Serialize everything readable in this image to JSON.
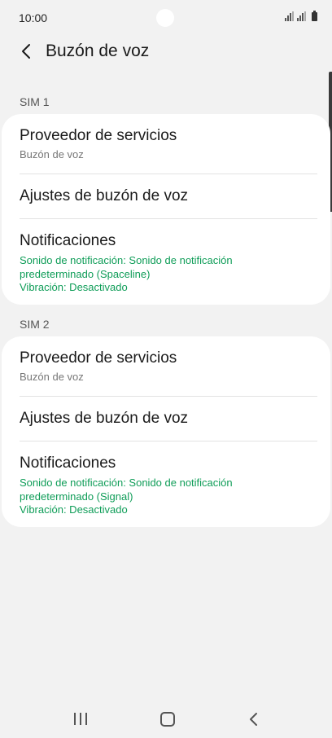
{
  "status_bar": {
    "time": "10:00"
  },
  "header": {
    "title": "Buzón de voz"
  },
  "sections": [
    {
      "label": "SIM 1",
      "items": [
        {
          "title": "Proveedor de servicios",
          "subtitle": "Buzón de voz"
        },
        {
          "title": "Ajustes de buzón de voz"
        },
        {
          "title": "Notificaciones",
          "detail_line1": "Sonido de notificación: Sonido de notificación",
          "detail_line2": "predeterminado (Spaceline)",
          "detail_line3": "Vibración: Desactivado"
        }
      ]
    },
    {
      "label": "SIM 2",
      "items": [
        {
          "title": "Proveedor de servicios",
          "subtitle": "Buzón de voz"
        },
        {
          "title": "Ajustes de buzón de voz"
        },
        {
          "title": "Notificaciones",
          "detail_line1": "Sonido de notificación: Sonido de notificación",
          "detail_line2": "predeterminado (Signal)",
          "detail_line3": "Vibración: Desactivado"
        }
      ]
    }
  ],
  "icons": {
    "back": "chevron-left-icon",
    "signal": "signal-strength-icon",
    "battery": "battery-icon",
    "recents": "recent-apps-icon",
    "home": "home-icon",
    "nav_back": "back-icon"
  },
  "colors": {
    "background": "#f2f2f2",
    "card": "#ffffff",
    "accent_green": "#0f9d58"
  }
}
